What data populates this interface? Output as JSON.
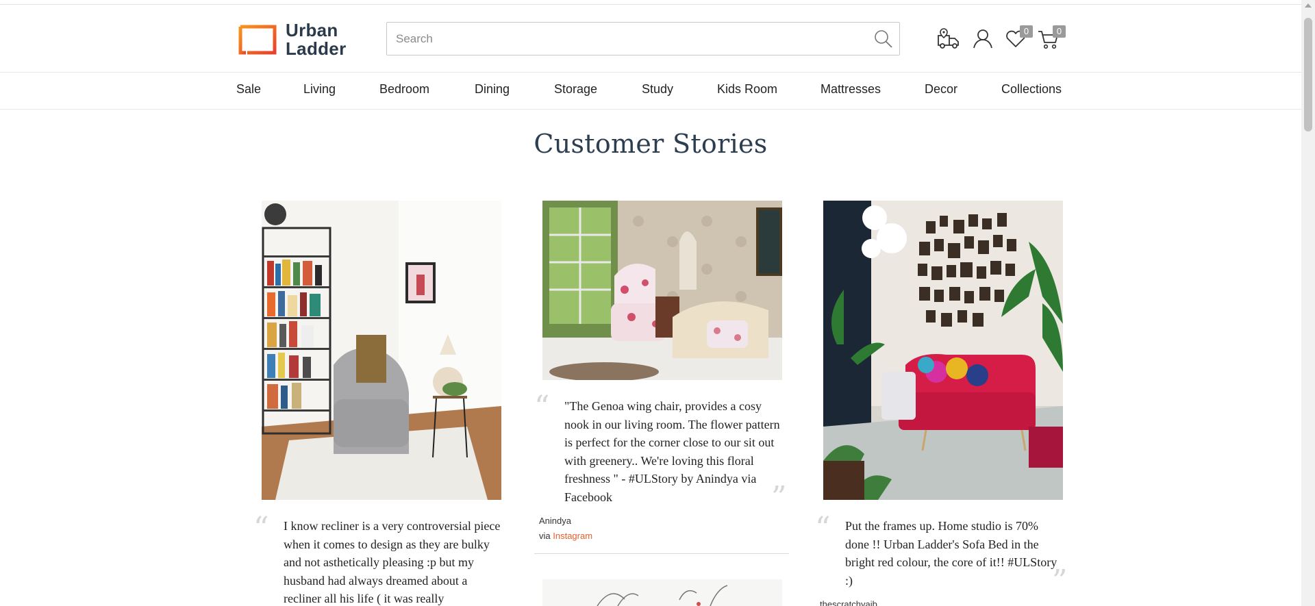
{
  "brand": {
    "line1": "Urban",
    "line2": "Ladder",
    "accent_color": "#f26a2e"
  },
  "search": {
    "placeholder": "Search",
    "value": ""
  },
  "header_icons": [
    {
      "name": "delivery-location-icon"
    },
    {
      "name": "user-icon"
    },
    {
      "name": "wishlist-heart-icon",
      "count": "0"
    },
    {
      "name": "cart-icon",
      "count": "0"
    }
  ],
  "nav": {
    "items": [
      "Sale",
      "Living",
      "Bedroom",
      "Dining",
      "Storage",
      "Study",
      "Kids Room",
      "Mattresses",
      "Decor",
      "Collections"
    ]
  },
  "page": {
    "title": "Customer Stories"
  },
  "stories": [
    {
      "text": "I know recliner is a very controversial piece when it comes to design as they are bulky and not asthetically pleasing :p but my husband had always dreamed about a recliner all his life ( it was really"
    },
    {
      "text": "\"The Genoa wing chair, provides a cosy nook in our living room. The flower pattern is perfect for the corner close to our sit out with greenery.. We're loving this floral freshness \" - #ULStory by Anindya via Facebook",
      "author": "Anindya",
      "via_prefix": "via",
      "via_source": "Instagram"
    },
    {
      "text": "Put the frames up. Home studio is 70% done !! Urban Ladder's Sofa Bed in the bright red colour, the core of it!! #ULStory :)",
      "author": "thescratchyaib"
    }
  ],
  "colors": {
    "title": "#2c3e50",
    "link": "#e85d2a",
    "badge": "#9a9a9a"
  }
}
